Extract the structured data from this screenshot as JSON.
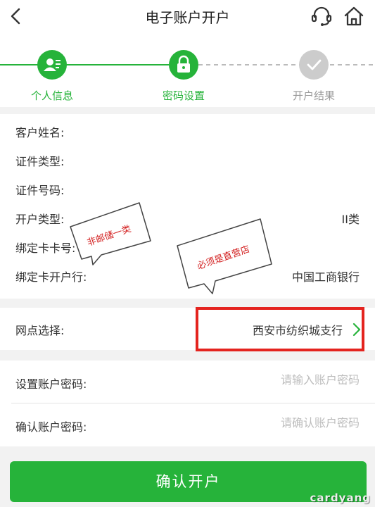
{
  "header": {
    "title": "电子账户开户",
    "back_icon": "chevron-left-icon",
    "service_icon": "headset-icon",
    "home_icon": "home-icon"
  },
  "steps": [
    {
      "label": "个人信息",
      "icon": "person-card-icon",
      "status": "done"
    },
    {
      "label": "密码设置",
      "icon": "lock-icon",
      "status": "active"
    },
    {
      "label": "开户结果",
      "icon": "check-icon",
      "status": "pending"
    }
  ],
  "info": {
    "rows": [
      {
        "label": "客户姓名:",
        "value": ""
      },
      {
        "label": "证件类型:",
        "value": ""
      },
      {
        "label": "证件号码:",
        "value": ""
      },
      {
        "label": "开户类型:",
        "value": "II类"
      },
      {
        "label": "绑定卡卡号:",
        "value": ""
      },
      {
        "label": "绑定卡开户行:",
        "value": "中国工商银行"
      }
    ]
  },
  "branch": {
    "label": "网点选择:",
    "value": "西安市纺织城支行"
  },
  "password": {
    "set_label": "设置账户密码:",
    "set_placeholder": "请输入账户密码",
    "confirm_label": "确认账户密码:",
    "confirm_placeholder": "请确认账户密码"
  },
  "confirm_button": "确认开户",
  "annotations": {
    "note1": "非邮储一类",
    "note2": "必须是直营店"
  },
  "watermark": "cardyang",
  "colors": {
    "accent": "#26b33a",
    "pending": "#cccccc",
    "annotation": "#e4241f"
  }
}
